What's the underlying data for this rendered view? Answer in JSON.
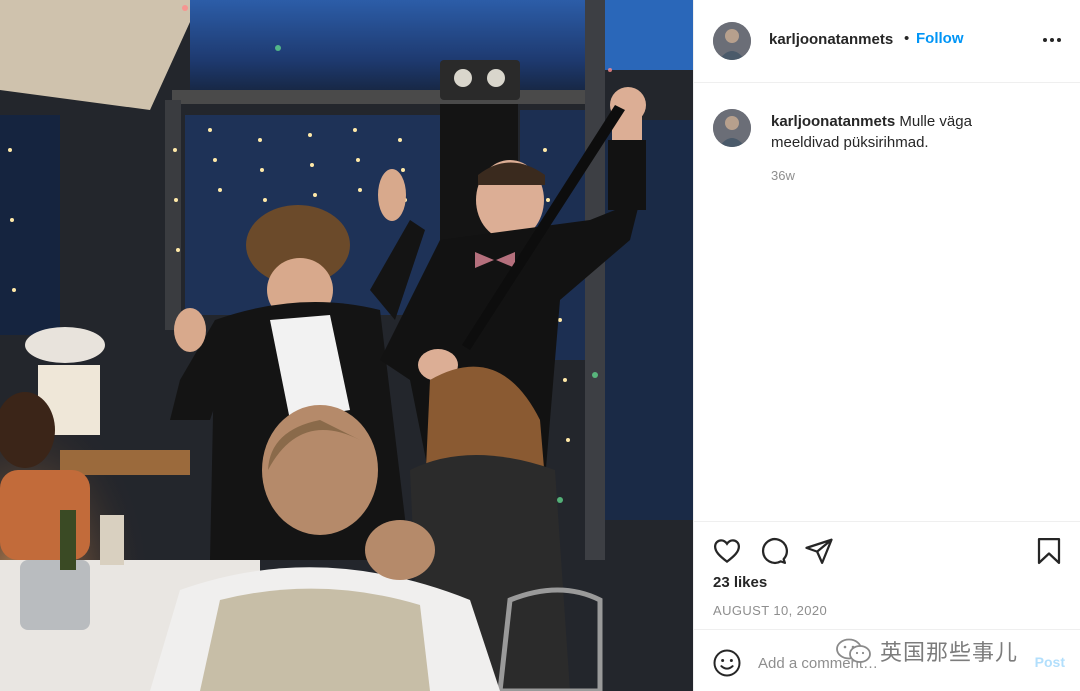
{
  "post": {
    "username": "karljoonatanmets",
    "separator": "•",
    "follow_label": "Follow",
    "more_icon": "more-horizontal-icon"
  },
  "caption": {
    "username": "karljoonatanmets",
    "text": "Mulle väga meeldivad püksirihmad.",
    "time": "36w"
  },
  "actions": {
    "like_icon": "heart-icon",
    "comment_icon": "comment-icon",
    "share_icon": "paper-plane-icon",
    "save_icon": "bookmark-icon",
    "likes": "23 likes",
    "date": "AUGUST 10, 2020"
  },
  "add_comment": {
    "emoji_icon": "emoji-icon",
    "placeholder": "Add a comment…",
    "post_label": "Post"
  },
  "watermark": {
    "text": "英国那些事儿"
  },
  "colors": {
    "accent": "#0095f6",
    "post_disabled": "#b2dffc",
    "muted": "#8e8e8e"
  }
}
